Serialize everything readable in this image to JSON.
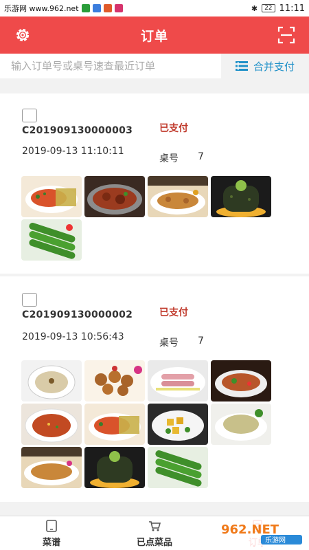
{
  "status_bar": {
    "site": "乐游网 www.962.net",
    "battery": "22",
    "time": "11:11"
  },
  "header": {
    "title": "订单",
    "left_icon": "gear-icon",
    "right_icon": "scan-icon"
  },
  "search": {
    "placeholder": "输入订单号或桌号速查最近订单",
    "merge_label": "合并支付",
    "merge_icon": "list-icon"
  },
  "orders": [
    {
      "order_no": "C201909130000003",
      "time": "2019-09-13 11:10:11",
      "status": "已支付",
      "table_label": "桌号",
      "table_no": "7",
      "dishes": [
        "fish-dish",
        "braised-meat-dish",
        "chicken-feet-dish",
        "seaweed-dish",
        "cucumber-dish"
      ]
    },
    {
      "order_no": "C201909130000002",
      "time": "2019-09-13 10:56:43",
      "status": "已支付",
      "table_label": "桌号",
      "table_no": "7",
      "dishes": [
        "soup-dish",
        "braised-eggs-dish",
        "meat-rolls-dish",
        "spicy-chicken-dish",
        "noodle-soup-dish",
        "fish-dish",
        "tofu-dish",
        "boiled-chicken-dish",
        "chicken-feet-dish",
        "seaweed-dish",
        "cucumber-dish"
      ]
    }
  ],
  "bottom_nav": [
    {
      "label": "菜谱",
      "icon": "tablet-icon"
    },
    {
      "label": "已点菜品",
      "icon": "cart-icon"
    },
    {
      "label": "订单",
      "icon": "order-icon"
    }
  ],
  "watermark": {
    "brand": "962.NET",
    "sub": "乐游网"
  },
  "colors": {
    "header": "#ef4a4a",
    "status": "#c0392b",
    "merge": "#1e90c8"
  }
}
